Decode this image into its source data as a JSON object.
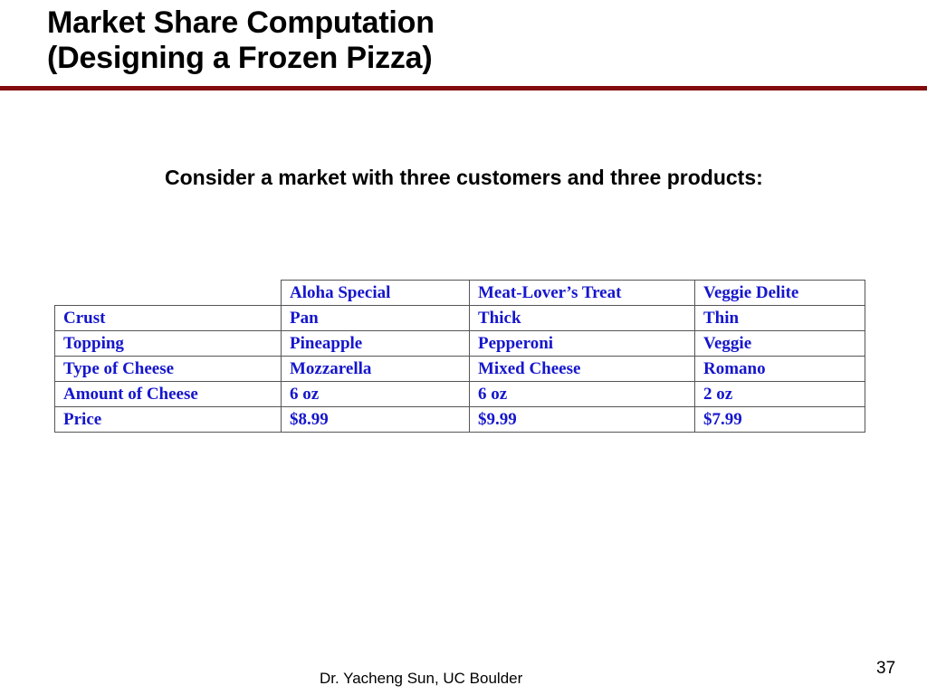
{
  "slide": {
    "title": "Market Share Computation\n(Designing a Frozen Pizza)",
    "rule_color": "#820B0B",
    "intro_text": "Consider a market with three customers and three products:",
    "footer_credit": "Dr. Yacheng Sun, UC Boulder",
    "page_number": "37",
    "text_color": "#000000",
    "table_text_color": "#1516CC"
  },
  "table": {
    "corner_label": "",
    "column_headers": [
      "Aloha Special",
      "Meat-Lover’s Treat",
      "Veggie Delite"
    ],
    "rows": [
      {
        "label": "Crust",
        "values": [
          "Pan",
          "Thick",
          "Thin"
        ]
      },
      {
        "label": "Topping",
        "values": [
          "Pineapple",
          "Pepperoni",
          "Veggie"
        ]
      },
      {
        "label": "Type of Cheese",
        "values": [
          "Mozzarella",
          "Mixed Cheese",
          "Romano"
        ]
      },
      {
        "label": "Amount of Cheese",
        "values": [
          "6 oz",
          "6 oz",
          "2 oz"
        ]
      },
      {
        "label": "Price",
        "values": [
          "$8.99",
          "$9.99",
          "$7.99"
        ]
      }
    ]
  }
}
